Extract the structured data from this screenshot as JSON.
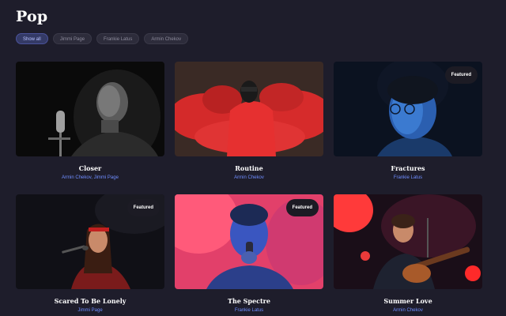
{
  "page": {
    "title": "Pop"
  },
  "filters": [
    {
      "label": "Show all",
      "active": true
    },
    {
      "label": "Jimmi Page",
      "active": false
    },
    {
      "label": "Frankie Latus",
      "active": false
    },
    {
      "label": "Armin Chekov",
      "active": false
    }
  ],
  "cards": [
    {
      "title": "Closer",
      "artists": "Armin Chekov, Jimmi Page",
      "badge": "",
      "image": "singer-microphone-bw-photo"
    },
    {
      "title": "Routine",
      "artists": "Armin Chekov",
      "badge": "",
      "image": "red-smoke-performer-photo"
    },
    {
      "title": "Fractures",
      "artists": "Frankie Latus",
      "badge": "Featured",
      "image": "blue-lit-portrait-photo"
    },
    {
      "title": "Scared To Be Lonely",
      "artists": "Jimmi Page",
      "badge": "Featured",
      "image": "female-singer-stage-photo"
    },
    {
      "title": "The Spectre",
      "artists": "Frankie Latus",
      "badge": "Featured",
      "image": "neon-painted-singer-photo"
    },
    {
      "title": "Summer Love",
      "artists": "Armin Chekov",
      "badge": "",
      "image": "guitarist-concert-photo"
    }
  ],
  "colors": {
    "background": "#1e1d2b",
    "accent_link": "#6f8dff",
    "chip_active_bg": "#343a66",
    "chip_inactive_bg": "#2d2c3b"
  }
}
